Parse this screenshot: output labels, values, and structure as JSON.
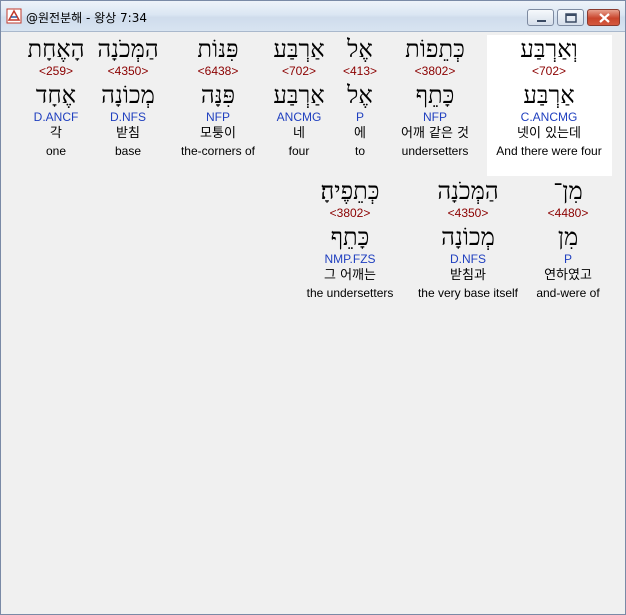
{
  "window": {
    "title": "@원전분해 - 왕상 7:34"
  },
  "colors": {
    "hebrew": "#000000",
    "strong": "#8b0000",
    "morph": "#1f3fbf",
    "highlight_bg": "#ffffff"
  },
  "rows": [
    {
      "words": [
        {
          "heb": "וְאַרְבַּע",
          "strong": "<702>",
          "lemma": "אַרְבַּע",
          "morph": "C.ANCMG",
          "kor": "넷이 있는데",
          "eng": "And there were four",
          "highlighted": true
        },
        {
          "heb": "כְּתֵפוֹת",
          "strong": "<3802>",
          "lemma": "כָּתֵף",
          "morph": "NFP",
          "kor": "어깨 같은 것",
          "eng": "undersetters"
        },
        {
          "heb": "אֶל",
          "strong": "<413>",
          "lemma": "אֶל",
          "morph": "P",
          "kor": "에",
          "eng": "to"
        },
        {
          "heb": "אַרְבַּע",
          "strong": "<702>",
          "lemma": "אַרְבַּע",
          "morph": "ANCMG",
          "kor": "네",
          "eng": "four"
        },
        {
          "heb": "פִּנּוֹת",
          "strong": "<6438>",
          "lemma": "פִּנָּה",
          "morph": "NFP",
          "kor": "모퉁이",
          "eng": "the-corners of"
        },
        {
          "heb": "הַמְּכֹנָה",
          "strong": "<4350>",
          "lemma": "מְכוֹנָה",
          "morph": "D.NFS",
          "kor": "받침",
          "eng": "base"
        },
        {
          "heb": "הָאֶחָת",
          "strong": "<259>",
          "lemma": "אֶחָד",
          "morph": "D.ANCF",
          "kor": "각",
          "eng": "one"
        }
      ]
    },
    {
      "words": [
        {
          "heb": "מִן־",
          "strong": "<4480>",
          "lemma": "מִן",
          "morph": "P",
          "kor": "연하였고",
          "eng": "and-were of"
        },
        {
          "heb": "הַמְּכֹנָה",
          "strong": "<4350>",
          "lemma": "מְכוֹנָה",
          "morph": "D.NFS",
          "kor": "받침과",
          "eng": "the very base itself"
        },
        {
          "heb": "כְּתֵפֶיהָ׃",
          "strong": "<3802>",
          "lemma": "כָּתֵף",
          "morph": "NMP.FZS",
          "kor": "그 어깨는",
          "eng": "the undersetters"
        }
      ]
    }
  ]
}
